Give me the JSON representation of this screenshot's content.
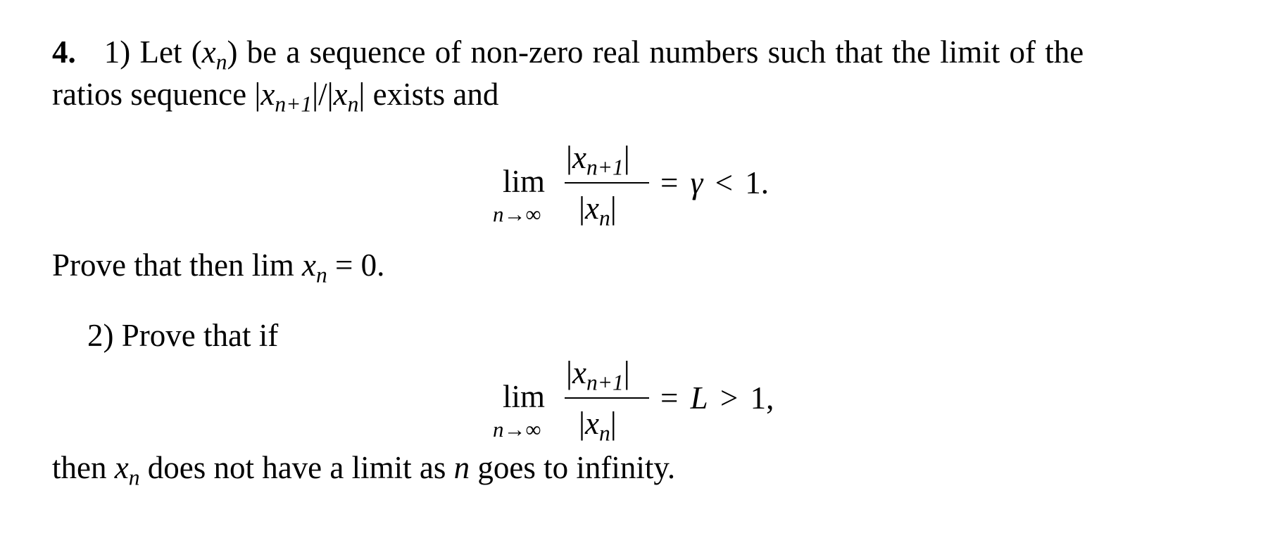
{
  "problem": {
    "number": "4.",
    "part1": {
      "label": "1)",
      "intro_a": "Let (",
      "intro_var": "x",
      "intro_sub": "n",
      "intro_b": ") be a sequence of non-zero real numbers such that the limit of the",
      "line2_a": "ratios sequence |",
      "line2_var1": "x",
      "line2_sub1": "n+1",
      "line2_mid": "|/|",
      "line2_var2": "x",
      "line2_sub2": "n",
      "line2_b": "| exists and",
      "display": {
        "lim": "lim",
        "lim_sub_var": "n",
        "lim_sub_rest": "→∞",
        "numerator_open": "|",
        "numerator_var": "x",
        "numerator_sub": "n+1",
        "numerator_close": "|",
        "denominator_open": "|",
        "denominator_var": "x",
        "denominator_sub": "n",
        "denominator_close": "|",
        "rhs_eq": "=",
        "rhs_symbol": "γ",
        "rhs_rel": "<",
        "rhs_value": "1",
        "rhs_punct": "."
      },
      "conclusion_a": "Prove that then lim ",
      "conclusion_var": "x",
      "conclusion_sub": "n",
      "conclusion_b": " = 0."
    },
    "part2": {
      "label": "2)",
      "intro": "Prove that if",
      "display": {
        "lim": "lim",
        "lim_sub_var": "n",
        "lim_sub_rest": "→∞",
        "numerator_open": "|",
        "numerator_var": "x",
        "numerator_sub": "n+1",
        "numerator_close": "|",
        "denominator_open": "|",
        "denominator_var": "x",
        "denominator_sub": "n",
        "denominator_close": "|",
        "rhs_eq": "=",
        "rhs_symbol": "L",
        "rhs_rel": ">",
        "rhs_value": "1",
        "rhs_punct": ","
      },
      "conclusion_a": "then ",
      "conclusion_var": "x",
      "conclusion_sub": "n",
      "conclusion_b": " does not have a limit as ",
      "conclusion_var2": "n",
      "conclusion_c": " goes to infinity."
    }
  }
}
